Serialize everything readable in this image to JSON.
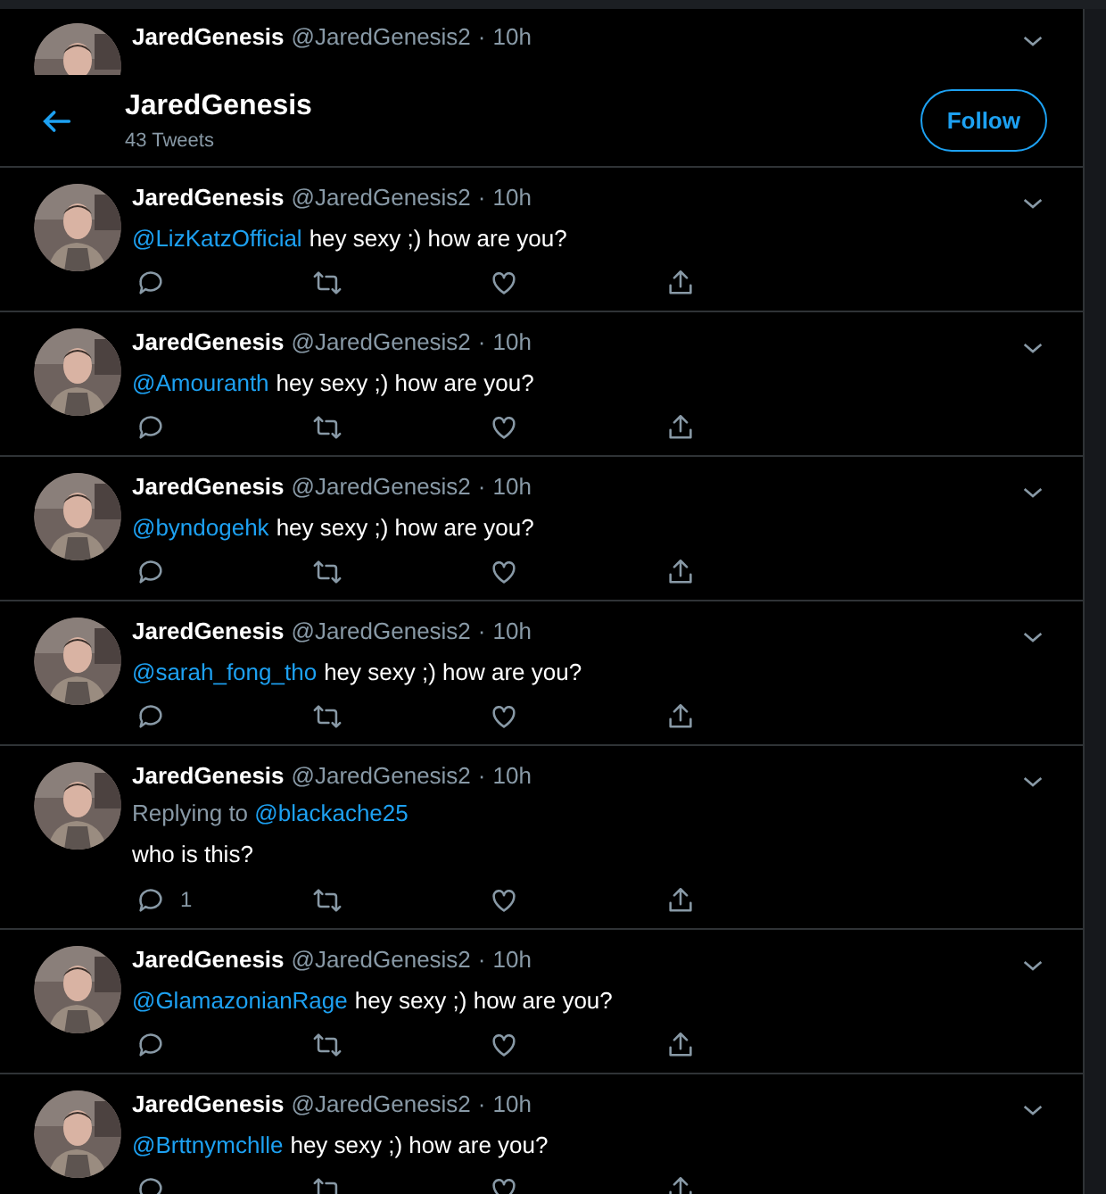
{
  "partial_tweet": {
    "name": "JaredGenesis",
    "handle": "@JaredGenesis2",
    "separator": "·",
    "time": "10h"
  },
  "header": {
    "title": "JaredGenesis",
    "subtitle": "43 Tweets",
    "follow_button": "Follow"
  },
  "tweets": [
    {
      "name": "JaredGenesis",
      "handle": "@JaredGenesis2",
      "separator": "·",
      "time": "10h",
      "mention": "@LizKatzOfficial",
      "text": "hey sexy ;) how are you?"
    },
    {
      "name": "JaredGenesis",
      "handle": "@JaredGenesis2",
      "separator": "·",
      "time": "10h",
      "mention": "@Amouranth",
      "text": "hey sexy ;) how are you?"
    },
    {
      "name": "JaredGenesis",
      "handle": "@JaredGenesis2",
      "separator": "·",
      "time": "10h",
      "mention": "@byndogehk",
      "text": "hey sexy ;) how are you?"
    },
    {
      "name": "JaredGenesis",
      "handle": "@JaredGenesis2",
      "separator": "·",
      "time": "10h",
      "mention": "@sarah_fong_tho",
      "text": "hey sexy ;) how are you?"
    },
    {
      "name": "JaredGenesis",
      "handle": "@JaredGenesis2",
      "separator": "·",
      "time": "10h",
      "replying_label": "Replying to",
      "replying_to": "@blackache25",
      "text": "who is this?",
      "reply_count": "1"
    },
    {
      "name": "JaredGenesis",
      "handle": "@JaredGenesis2",
      "separator": "·",
      "time": "10h",
      "mention": "@GlamazonianRage",
      "text": "hey sexy ;) how are you?"
    },
    {
      "name": "JaredGenesis",
      "handle": "@JaredGenesis2",
      "separator": "·",
      "time": "10h",
      "mention": "@Brttnymchlle",
      "text": "hey sexy ;) how are you?"
    }
  ]
}
